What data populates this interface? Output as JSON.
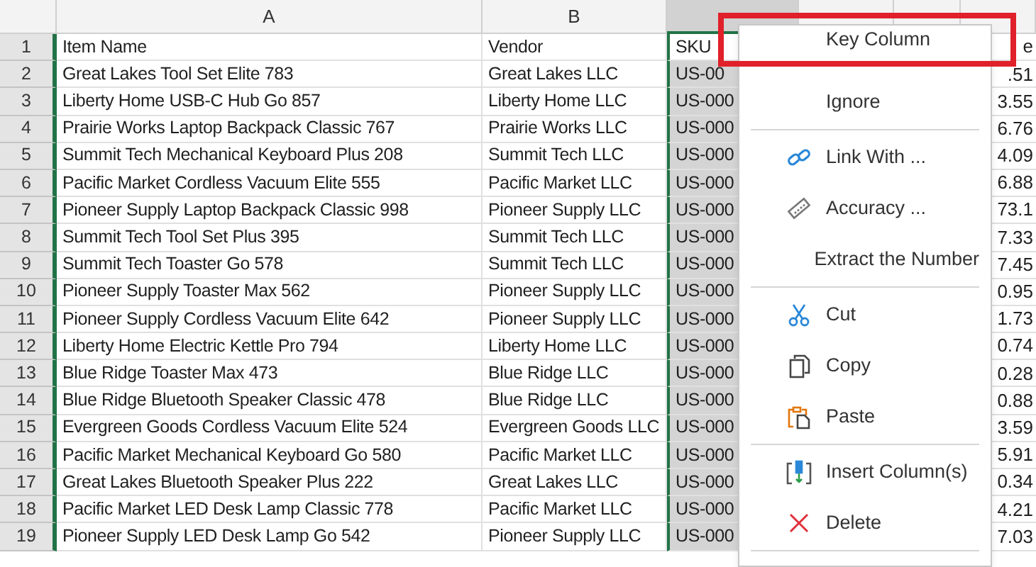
{
  "column_headers": [
    "A",
    "B"
  ],
  "rows": [
    {
      "number": "1",
      "item": "Item Name",
      "vendor": "Vendor",
      "sku": "SKU",
      "value": "e"
    },
    {
      "number": "2",
      "item": "Great Lakes Tool Set Elite 783",
      "vendor": "Great Lakes LLC",
      "sku": "US-00",
      "value": ".51"
    },
    {
      "number": "3",
      "item": "Liberty Home USB-C Hub Go 857",
      "vendor": "Liberty Home LLC",
      "sku": "US-000",
      "value": "3.55"
    },
    {
      "number": "4",
      "item": "Prairie Works Laptop Backpack Classic 767",
      "vendor": "Prairie Works LLC",
      "sku": "US-000",
      "value": "6.76"
    },
    {
      "number": "5",
      "item": "Summit Tech Mechanical Keyboard Plus 208",
      "vendor": "Summit Tech LLC",
      "sku": "US-000",
      "value": "4.09"
    },
    {
      "number": "6",
      "item": "Pacific Market Cordless Vacuum Elite 555",
      "vendor": "Pacific Market LLC",
      "sku": "US-000",
      "value": "6.88"
    },
    {
      "number": "7",
      "item": "Pioneer Supply Laptop Backpack Classic 998",
      "vendor": "Pioneer Supply LLC",
      "sku": "US-000",
      "value": "73.1"
    },
    {
      "number": "8",
      "item": "Summit Tech Tool Set Plus 395",
      "vendor": "Summit Tech LLC",
      "sku": "US-000",
      "value": "7.33"
    },
    {
      "number": "9",
      "item": "Summit Tech Toaster Go 578",
      "vendor": "Summit Tech LLC",
      "sku": "US-000",
      "value": "7.45"
    },
    {
      "number": "10",
      "item": "Pioneer Supply Toaster Max 562",
      "vendor": "Pioneer Supply LLC",
      "sku": "US-000",
      "value": "0.95"
    },
    {
      "number": "11",
      "item": "Pioneer Supply Cordless Vacuum Elite 642",
      "vendor": "Pioneer Supply LLC",
      "sku": "US-000",
      "value": "1.73"
    },
    {
      "number": "12",
      "item": "Liberty Home Electric Kettle Pro 794",
      "vendor": "Liberty Home LLC",
      "sku": "US-000",
      "value": "0.74"
    },
    {
      "number": "13",
      "item": "Blue Ridge Toaster Max 473",
      "vendor": "Blue Ridge LLC",
      "sku": "US-000",
      "value": "0.28"
    },
    {
      "number": "14",
      "item": "Blue Ridge Bluetooth Speaker Classic 478",
      "vendor": "Blue Ridge LLC",
      "sku": "US-000",
      "value": "0.88"
    },
    {
      "number": "15",
      "item": "Evergreen Goods Cordless Vacuum Elite 524",
      "vendor": "Evergreen Goods LLC",
      "sku": "US-000",
      "value": "3.59"
    },
    {
      "number": "16",
      "item": "Pacific Market Mechanical Keyboard Go 580",
      "vendor": "Pacific Market LLC",
      "sku": "US-000",
      "value": "5.91"
    },
    {
      "number": "17",
      "item": "Great Lakes Bluetooth Speaker Plus 222",
      "vendor": "Great Lakes LLC",
      "sku": "US-000",
      "value": "0.34"
    },
    {
      "number": "18",
      "item": "Pacific Market LED Desk Lamp Classic 778",
      "vendor": "Pacific Market LLC",
      "sku": "US-000",
      "value": "4.21"
    },
    {
      "number": "19",
      "item": "Pioneer Supply LED Desk Lamp Go 542",
      "vendor": "Pioneer Supply LLC",
      "sku": "US-000",
      "value": "7.03"
    }
  ],
  "context_menu": [
    {
      "kind": "item",
      "label": "Key Column",
      "highlighted": true
    },
    {
      "kind": "item",
      "label": "Ignore",
      "highlighted": false
    },
    {
      "kind": "separator"
    },
    {
      "kind": "item",
      "label": "Link With ...",
      "highlighted": false
    },
    {
      "kind": "item",
      "label": "Accuracy ...",
      "highlighted": false
    },
    {
      "kind": "item",
      "label": "Extract the Number",
      "highlighted": false
    },
    {
      "kind": "separator"
    },
    {
      "kind": "item",
      "label": "Cut",
      "highlighted": false
    },
    {
      "kind": "item",
      "label": "Copy",
      "highlighted": false
    },
    {
      "kind": "item",
      "label": "Paste",
      "highlighted": false
    },
    {
      "kind": "separator"
    },
    {
      "kind": "item",
      "label": "Insert Column(s)",
      "highlighted": false
    },
    {
      "kind": "item",
      "label": "Delete",
      "highlighted": false
    },
    {
      "kind": "separator"
    }
  ]
}
